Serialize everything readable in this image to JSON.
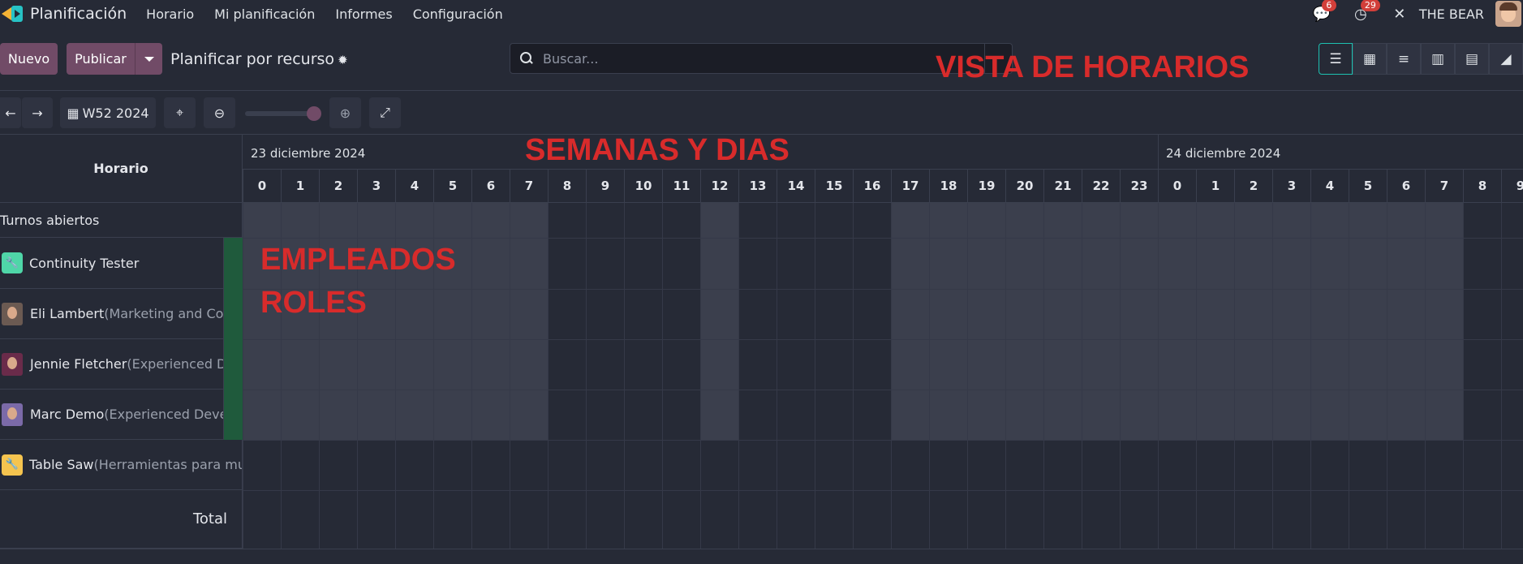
{
  "navbar": {
    "app_title": "Planificación",
    "menu": [
      "Horario",
      "Mi planificación",
      "Informes",
      "Configuración"
    ],
    "messages_badge": "6",
    "activity_badge": "29",
    "company": "THE BEAR"
  },
  "control": {
    "new_label": "Nuevo",
    "publish_label": "Publicar",
    "view_title": "Planificar por recurso",
    "search_placeholder": "Buscar..."
  },
  "toolbar": {
    "week_label": "W52 2024"
  },
  "annotations": {
    "views": "VISTA DE HORARIOS",
    "days": "SEMANAS Y DIAS",
    "employees_line1": "EMPLEADOS",
    "employees_line2": "ROLES"
  },
  "grid": {
    "header": "Horario",
    "day1": "23 diciembre 2024",
    "day2": "24 diciembre 2024",
    "hours": [
      "0",
      "1",
      "2",
      "3",
      "4",
      "5",
      "6",
      "7",
      "8",
      "9",
      "10",
      "11",
      "12",
      "13",
      "14",
      "15",
      "16",
      "17",
      "18",
      "19",
      "20",
      "21",
      "22",
      "23",
      "0",
      "1",
      "2",
      "3",
      "4",
      "5",
      "6",
      "7",
      "8",
      "9"
    ],
    "rows": [
      {
        "name": "Turnos abiertos",
        "role": ""
      },
      {
        "name": "Continuity Tester",
        "role": ""
      },
      {
        "name": "Eli Lambert",
        "role": "(Marketing and Com..."
      },
      {
        "name": "Jennie Fletcher",
        "role": "(Experienced Dev..."
      },
      {
        "name": "Marc Demo",
        "role": "(Experienced Develo..."
      },
      {
        "name": "Table Saw",
        "role": "(Herramientas para mu..."
      }
    ],
    "total_label": "Total"
  },
  "colors": {
    "accent": "#714b67",
    "active_view": "#1dc1b1",
    "annotation": "#d82b2b",
    "badge": "#d23f3a"
  },
  "icons": [
    "app-logo",
    "chat-icon",
    "clock-icon",
    "tools-icon",
    "search-icon",
    "gear-icon",
    "calendar-icon",
    "crosshair-icon",
    "zoom-out-icon",
    "zoom-in-icon",
    "expand-icon",
    "wrench-icon"
  ]
}
